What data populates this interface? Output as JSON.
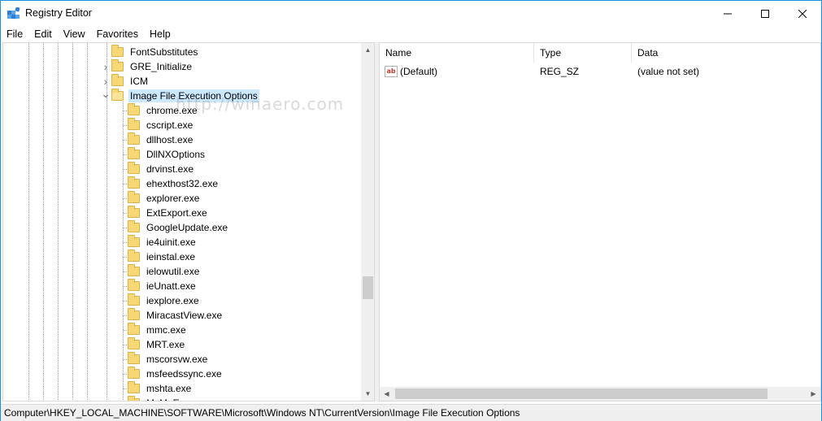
{
  "window": {
    "title": "Registry Editor",
    "controls": {
      "minimize": "—",
      "maximize": "☐",
      "close": "✕"
    }
  },
  "menu": [
    "File",
    "Edit",
    "View",
    "Favorites",
    "Help"
  ],
  "tree": {
    "parents": [
      {
        "label": "FontSubstitutes",
        "expandable": false
      },
      {
        "label": "GRE_Initialize",
        "expandable": true
      },
      {
        "label": "ICM",
        "expandable": true
      },
      {
        "label": "Image File Execution Options",
        "expandable": true,
        "expanded": true,
        "selected": true
      }
    ],
    "children": [
      "chrome.exe",
      "cscript.exe",
      "dllhost.exe",
      "DllNXOptions",
      "drvinst.exe",
      "ehexthost32.exe",
      "explorer.exe",
      "ExtExport.exe",
      "GoogleUpdate.exe",
      "ie4uinit.exe",
      "ieinstal.exe",
      "ielowutil.exe",
      "ieUnatt.exe",
      "iexplore.exe",
      "MiracastView.exe",
      "mmc.exe",
      "MRT.exe",
      "mscorsvw.exe",
      "msfeedssync.exe",
      "mshta.exe",
      "MsMpEng.exe"
    ]
  },
  "values": {
    "columns": [
      "Name",
      "Type",
      "Data"
    ],
    "rows": [
      {
        "icon": "ab",
        "name": "(Default)",
        "type": "REG_SZ",
        "data": "(value not set)"
      }
    ]
  },
  "status": {
    "path": "Computer\\HKEY_LOCAL_MACHINE\\SOFTWARE\\Microsoft\\Windows NT\\CurrentVersion\\Image File Execution Options"
  },
  "watermark": "http://winaero.com",
  "colors": {
    "accent": "#1e8fe0",
    "selection": "#cce8ff",
    "folder": "#f8d775"
  }
}
